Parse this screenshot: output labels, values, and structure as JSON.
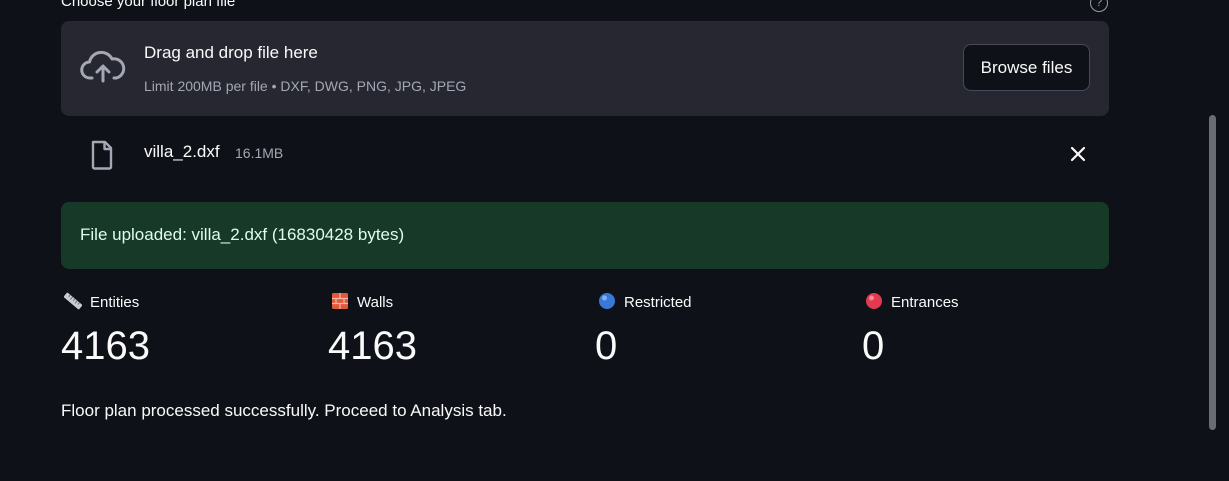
{
  "uploader": {
    "label": "Choose your floor plan file",
    "help_icon": "question-circle-icon",
    "dropzone": {
      "icon": "cloud-upload-icon",
      "title": "Drag and drop file here",
      "limit_text": "Limit 200MB per file • DXF, DWG, PNG, JPG, JPEG",
      "browse_label": "Browse files"
    },
    "file": {
      "icon": "file-icon",
      "name": "villa_2.dxf",
      "size": "16.1MB",
      "remove_icon": "close-icon"
    }
  },
  "success": {
    "message": "File uploaded: villa_2.dxf (16830428 bytes)",
    "color": "#173928"
  },
  "metrics": [
    {
      "icon": "ruler-icon",
      "label": "Entities",
      "value": "4163"
    },
    {
      "icon": "brick-icon",
      "label": "Walls",
      "value": "4163"
    },
    {
      "icon": "blue-circle-icon",
      "label": "Restricted",
      "value": "0"
    },
    {
      "icon": "red-circle-icon",
      "label": "Entrances",
      "value": "0"
    }
  ],
  "status": "Floor plan processed successfully. Proceed to Analysis tab.",
  "colors": {
    "background": "#0e1117",
    "dropzone": "#262730",
    "success_bg": "#173928"
  }
}
